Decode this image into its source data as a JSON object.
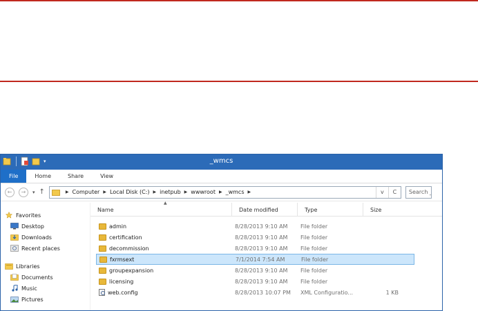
{
  "window": {
    "title": "_wmcs"
  },
  "ribbon": {
    "tabs": [
      "File",
      "Home",
      "Share",
      "View"
    ]
  },
  "address": {
    "crumbs": [
      "Computer",
      "Local Disk (C:)",
      "inetpub",
      "wwwroot",
      "_wmcs"
    ],
    "dropdown": "v",
    "refresh": "C"
  },
  "search": {
    "placeholder": "Search _"
  },
  "nav": {
    "favorites": "Favorites",
    "favorites_items": [
      "Desktop",
      "Downloads",
      "Recent places"
    ],
    "libraries": "Libraries",
    "libraries_items": [
      "Documents",
      "Music",
      "Pictures"
    ]
  },
  "columns": {
    "name": "Name",
    "date": "Date modified",
    "type": "Type",
    "size": "Size"
  },
  "files": [
    {
      "name": "admin",
      "date": "8/28/2013 9:10 AM",
      "type": "File folder",
      "size": "",
      "kind": "folder"
    },
    {
      "name": "certification",
      "date": "8/28/2013 9:10 AM",
      "type": "File folder",
      "size": "",
      "kind": "folder"
    },
    {
      "name": "decommission",
      "date": "8/28/2013 9:10 AM",
      "type": "File folder",
      "size": "",
      "kind": "folder"
    },
    {
      "name": "fxrmsext",
      "date": "7/1/2014 7:54 AM",
      "type": "File folder",
      "size": "",
      "kind": "folder",
      "selected": true
    },
    {
      "name": "groupexpansion",
      "date": "8/28/2013 9:10 AM",
      "type": "File folder",
      "size": "",
      "kind": "folder"
    },
    {
      "name": "licensing",
      "date": "8/28/2013 9:10 AM",
      "type": "File folder",
      "size": "",
      "kind": "folder"
    },
    {
      "name": "web.config",
      "date": "8/28/2013 10:07 PM",
      "type": "XML Configuratio...",
      "size": "1 KB",
      "kind": "config"
    }
  ],
  "colors": {
    "accent_rule": "#c0281e",
    "titlebar": "#2c6bb8",
    "file_tab": "#1e6fc8",
    "selection": "#cce6fb"
  }
}
